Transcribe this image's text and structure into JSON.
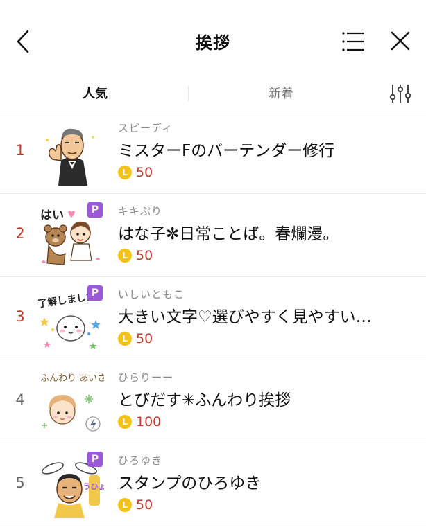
{
  "header": {
    "title": "挨拶"
  },
  "tabs": {
    "popular": "人気",
    "new": "新着"
  },
  "items": [
    {
      "rank": "1",
      "author": "スピーディ",
      "title": "ミスターFのバーテンダー修行",
      "price": "50",
      "premium": false
    },
    {
      "rank": "2",
      "author": "キキぷり",
      "title": "はな子✼日常ことば。春爛漫。",
      "price": "50",
      "premium": true,
      "thumb_text": "はい"
    },
    {
      "rank": "3",
      "author": "いしいともこ",
      "title": "大きい文字♡選びやすく見やすい…",
      "price": "50",
      "premium": true,
      "thumb_text": "了解しました"
    },
    {
      "rank": "4",
      "author": "ひらりーー",
      "title": "とびだす✳ふんわり挨拶",
      "price": "100",
      "premium": false,
      "thumb_text": "ふんわり あいさつ"
    },
    {
      "rank": "5",
      "author": "ひろゆき",
      "title": "スタンプのひろゆき",
      "price": "50",
      "premium": true,
      "thumb_text": "うひょ"
    }
  ],
  "badge": {
    "premium": "P",
    "coin": "L"
  },
  "colors": {
    "rank_top": "#c0392b",
    "price": "#c0392b",
    "coin": "#f3c21a",
    "premium_badge": "#9b59d6"
  },
  "icons": [
    "back-icon",
    "menu-icon",
    "close-icon",
    "filter-icon",
    "coin-icon"
  ]
}
